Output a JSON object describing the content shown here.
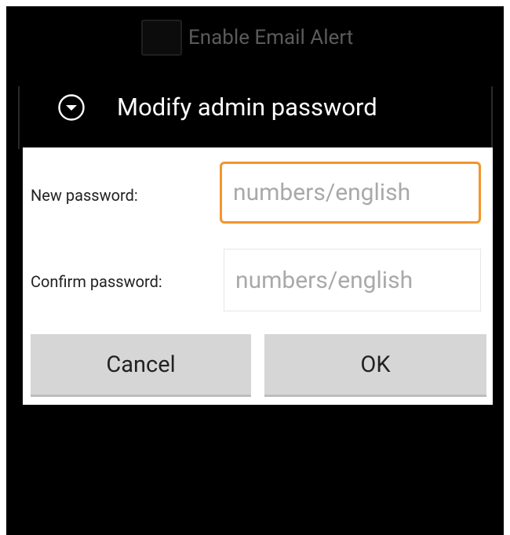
{
  "background": {
    "email_alert_label": "Enable Email Alert"
  },
  "dialog": {
    "title": "Modify admin password",
    "header_icon": "chevron-down-circle-icon",
    "new_password": {
      "label": "New password:",
      "value": "",
      "placeholder": "numbers/english"
    },
    "confirm_password": {
      "label": "Confirm password:",
      "value": "",
      "placeholder": "numbers/english"
    },
    "buttons": {
      "cancel": "Cancel",
      "ok": "OK"
    }
  },
  "colors": {
    "focus_border": "#f4942b",
    "button_bg": "#d6d6d6",
    "screen_bg": "#000000"
  }
}
